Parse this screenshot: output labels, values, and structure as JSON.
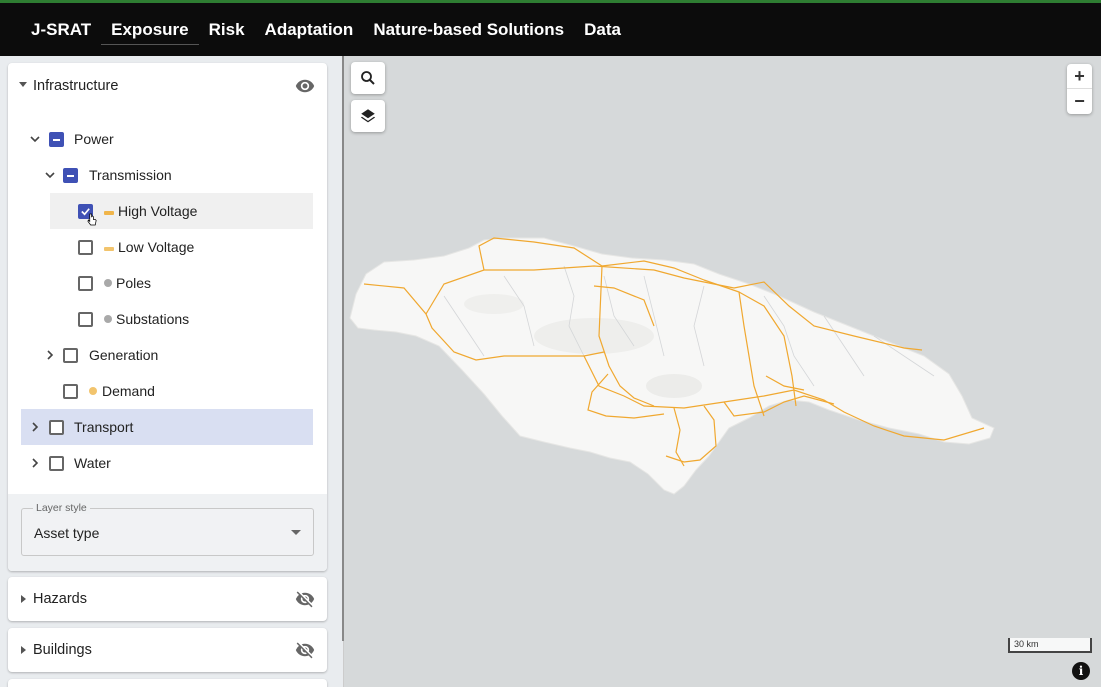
{
  "nav": {
    "brand": "J-SRAT",
    "items": [
      {
        "label": "Exposure",
        "active": true
      },
      {
        "label": "Risk"
      },
      {
        "label": "Adaptation"
      },
      {
        "label": "Nature-based Solutions"
      },
      {
        "label": "Data"
      }
    ]
  },
  "sidebar": {
    "infrastructure": {
      "title": "Infrastructure",
      "visible": true,
      "tree": {
        "power": "Power",
        "transmission": "Transmission",
        "high_voltage": "High Voltage",
        "low_voltage": "Low Voltage",
        "poles": "Poles",
        "substations": "Substations",
        "generation": "Generation",
        "demand": "Demand",
        "transport": "Transport",
        "water": "Water"
      },
      "checked": {
        "high_voltage": true,
        "low_voltage": false,
        "poles": false,
        "substations": false,
        "generation": false,
        "demand": false,
        "transport": false,
        "water": false
      },
      "layer_style": {
        "legend": "Layer style",
        "value": "Asset type"
      }
    },
    "hazards": {
      "title": "Hazards",
      "visible": false
    },
    "buildings": {
      "title": "Buildings",
      "visible": false
    }
  },
  "colors": {
    "high_voltage": "#f0b54a",
    "low_voltage": "#f2c46d",
    "poles": "#a9a9a9",
    "substations": "#a9a9a9",
    "demand": "#f2c46d",
    "accent": "#3f51b5",
    "map_lines": "#f0a830"
  },
  "map": {
    "scale_label": "30 km",
    "info_icon": "info-icon",
    "search_icon": "search-icon",
    "layers_icon": "layers-icon",
    "zoom_in": "+",
    "zoom_out": "−"
  }
}
